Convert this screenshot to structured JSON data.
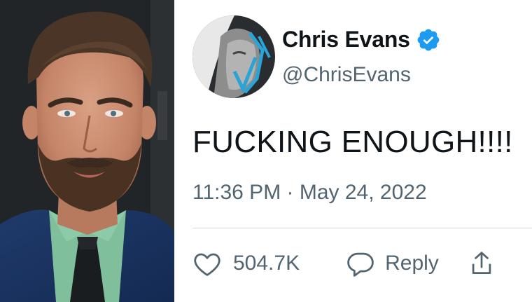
{
  "tweet": {
    "display_name": "Chris Evans",
    "handle": "@ChrisEvans",
    "text": "FUCKING ENOUGH!!!!",
    "timestamp": "11:36 PM · May 24, 2022",
    "likes_count": "504.7K",
    "reply_label": "Reply",
    "verified": true
  },
  "colors": {
    "verified_badge": "#1d9bf0",
    "name_text": "#0f1419",
    "secondary_text": "#536471",
    "separator": "#cfd9de"
  },
  "icons": {
    "like": "heart-outline-icon",
    "reply": "speech-bubble-icon",
    "share": "share-icon",
    "verified": "verified-badge-icon"
  }
}
